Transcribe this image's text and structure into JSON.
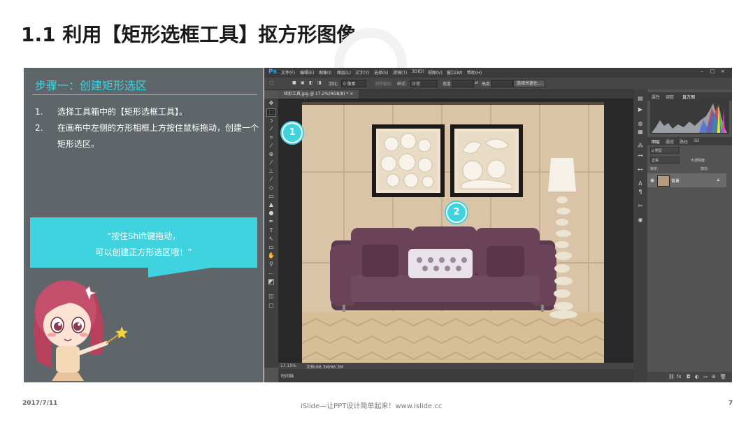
{
  "slide": {
    "title": "1.1 利用【矩形选框工具】抠方形图像",
    "step_title": "步骤一：创建矩形选区",
    "steps": [
      {
        "num": "1.",
        "text": "选择工具箱中的【矩形选框工具】。"
      },
      {
        "num": "2.",
        "text": "在画布中左侧的方形相框上方按住鼠标拖动，创建一个矩形选区。"
      }
    ],
    "bubble_line1": "“按住Shift键拖动，",
    "bubble_line2": "可以创建正方形选区哦！”",
    "footer_date": "2017/7/11",
    "footer_brand": "iSlide—让PPT设计简单起来！www.islide.cc",
    "footer_page": "7",
    "badge1": "1",
    "badge2": "2"
  },
  "ps": {
    "logo": "Ps",
    "menu": [
      "文件(F)",
      "编辑(E)",
      "图像(I)",
      "图层(L)",
      "文字(Y)",
      "选择(S)",
      "滤镜(T)",
      "3D(D)",
      "视图(V)",
      "窗口(W)",
      "帮助(H)"
    ],
    "options": {
      "feather_label": "羽化:",
      "feather_value": "0 像素",
      "antialias": "消除锯齿",
      "style_label": "样式:",
      "style_value": "正常",
      "width_label": "宽度:",
      "height_label": "高度:",
      "select_mask_button": "选择并遮住..."
    },
    "doc_tab": "矩形工具.jpg @ 17.2%(RGB/8) * ×",
    "status_zoom": "17.15%",
    "status_doc": "文档:66.3M/66.3M",
    "timeline": "时间轴",
    "panel_top_tabs": [
      "属性",
      "调整",
      "直方图"
    ],
    "panel_layer_tabs": [
      "图层",
      "通道",
      "路径",
      "3D"
    ],
    "layer_kind": "ρ 类型",
    "layer_blend": "正常",
    "layer_opacity": "不透明度:",
    "layer_lock": "锁定:",
    "layer_fill": "填充:",
    "layer_name": "背景"
  }
}
